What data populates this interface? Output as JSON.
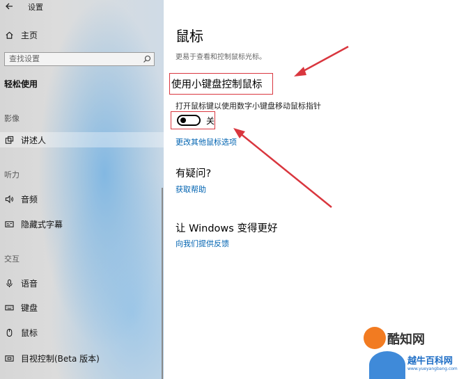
{
  "window": {
    "title": "设置"
  },
  "sidebar": {
    "home_label": "主页",
    "search_placeholder": "查找设置",
    "category_title": "轻松使用",
    "groups": [
      {
        "label": "影像",
        "items": [
          {
            "label": "讲述人",
            "icon": "narrator-icon"
          }
        ]
      },
      {
        "label": "听力",
        "items": [
          {
            "label": "音频",
            "icon": "speaker-icon"
          },
          {
            "label": "隐藏式字幕",
            "icon": "captions-icon"
          }
        ]
      },
      {
        "label": "交互",
        "items": [
          {
            "label": "语音",
            "icon": "microphone-icon"
          },
          {
            "label": "键盘",
            "icon": "keyboard-icon"
          },
          {
            "label": "鼠标",
            "icon": "mouse-icon"
          },
          {
            "label": "目视控制(Beta 版本)",
            "icon": "eye-control-icon"
          }
        ]
      }
    ]
  },
  "main": {
    "title": "鼠标",
    "subtitle": "更易于查看和控制鼠标光标。",
    "section_keypad": "使用小键盘控制鼠标",
    "toggle_desc": "打开鼠标键以使用数字小键盘移动鼠标指针",
    "toggle_state": "关",
    "toggle_on": false,
    "link_more": "更改其他鼠标选项",
    "section_help": "有疑问?",
    "link_help": "获取帮助",
    "section_improve": "让 Windows 变得更好",
    "link_feedback": "向我们提供反馈"
  },
  "watermark": {
    "brand_cn": "酷知网",
    "brand_cn2": "越牛百科网",
    "url": "www.yueyangbang.com"
  },
  "colors": {
    "accent_link": "#0063b1",
    "annotation": "#d9363e"
  }
}
